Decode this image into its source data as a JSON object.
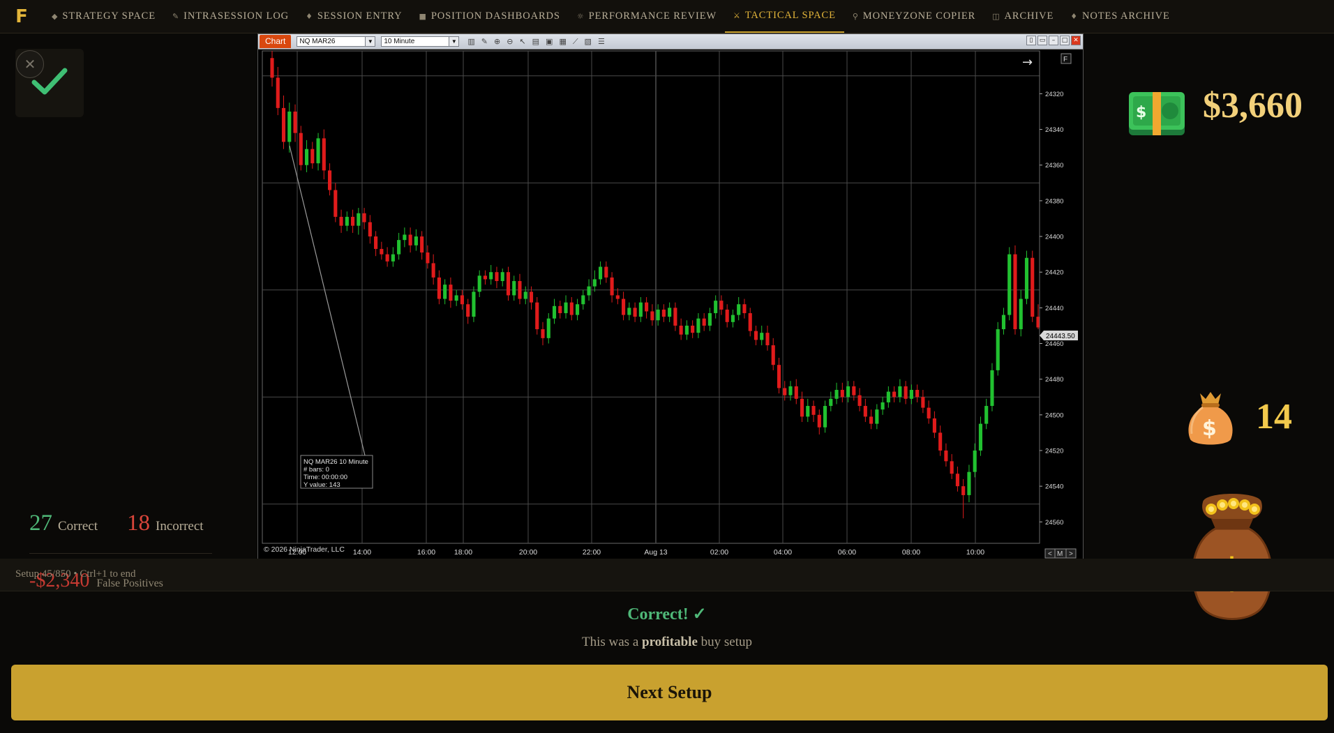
{
  "nav": {
    "logo": "F",
    "items": [
      {
        "icon": "◆",
        "label": "STRATEGY SPACE"
      },
      {
        "icon": "✎",
        "label": "INTRASESSION LOG"
      },
      {
        "icon": "♦",
        "label": "SESSION ENTRY"
      },
      {
        "icon": "■",
        "label": "POSITION DASHBOARDS"
      },
      {
        "icon": "☼",
        "label": "PERFORMANCE REVIEW"
      },
      {
        "icon": "⚔",
        "label": "TACTICAL SPACE"
      },
      {
        "icon": "⚲",
        "label": "MONEYZONE COPIER"
      },
      {
        "icon": "◫",
        "label": "ARCHIVE"
      },
      {
        "icon": "♦",
        "label": "NOTES ARCHIVE"
      }
    ],
    "active": "TACTICAL SPACE"
  },
  "left": {
    "close_glyph": "✕",
    "correct_count": "27",
    "correct_label": "Correct",
    "incorrect_count": "18",
    "incorrect_label": "Incorrect",
    "false_positive_value": "-$2,340",
    "false_positive_label": "False Positives"
  },
  "chart_window": {
    "tab": "Chart",
    "instrument": "NQ MAR26",
    "interval": "10 Minute",
    "corner_flag": "F",
    "arrow_glyph": "→",
    "copyright": "© 2026 NinjaTrader, LLC",
    "nav_buttons": [
      "<",
      "M",
      ">"
    ],
    "tooltip": [
      "NQ MAR26 10 Minute",
      "# bars:    0",
      "Time:      00:00:00",
      "Y value:  143"
    ],
    "price_tag": "24443.50"
  },
  "chart_data": {
    "type": "candlestick",
    "x_tick_labels": [
      "12:00",
      "14:00",
      "16:00",
      "18:00",
      "20:00",
      "22:00",
      "Aug 13",
      "02:00",
      "04:00",
      "06:00",
      "08:00",
      "10:00"
    ],
    "y_ticks": [
      24320,
      24340,
      24360,
      24380,
      24400,
      24420,
      24440,
      24460,
      24480,
      24500,
      24520,
      24540,
      24560
    ],
    "y_range": [
      24296,
      24572
    ],
    "y_axis_inverted": true,
    "last_price": 24443.5,
    "colors": {
      "up": "#21c130",
      "down": "#e01b1b",
      "background": "#000000",
      "grid": "#4a4a4a"
    },
    "candles": [
      [
        24300,
        24311,
        24296,
        24316
      ],
      [
        24311,
        24328,
        24305,
        24332
      ],
      [
        24328,
        24347,
        24321,
        24351
      ],
      [
        24347,
        24330,
        24325,
        24353
      ],
      [
        24330,
        24342,
        24326,
        24347
      ],
      [
        24342,
        24360,
        24338,
        24363
      ],
      [
        24360,
        24351,
        24346,
        24364
      ],
      [
        24351,
        24359,
        24347,
        24362
      ],
      [
        24359,
        24345,
        24342,
        24363
      ],
      [
        24345,
        24363,
        24340,
        24368
      ],
      [
        24363,
        24374,
        24359,
        24377
      ],
      [
        24374,
        24389,
        24370,
        24392
      ],
      [
        24389,
        24394,
        24385,
        24398
      ],
      [
        24394,
        24389,
        24386,
        24397
      ],
      [
        24389,
        24394,
        24385,
        24398
      ],
      [
        24394,
        24387,
        24384,
        24399
      ],
      [
        24387,
        24392,
        24384,
        24396
      ],
      [
        24392,
        24400,
        24388,
        24404
      ],
      [
        24400,
        24407,
        24397,
        24411
      ],
      [
        24407,
        24410,
        24403,
        24413
      ],
      [
        24410,
        24414,
        24406,
        24417
      ],
      [
        24414,
        24410,
        24406,
        24417
      ],
      [
        24410,
        24402,
        24398,
        24413
      ],
      [
        24402,
        24399,
        24395,
        24406
      ],
      [
        24399,
        24405,
        24395,
        24409
      ],
      [
        24405,
        24400,
        24396,
        24408
      ],
      [
        24400,
        24409,
        24397,
        24413
      ],
      [
        24409,
        24415,
        24405,
        24418
      ],
      [
        24415,
        24423,
        24410,
        24427
      ],
      [
        24423,
        24435,
        24419,
        24438
      ],
      [
        24435,
        24427,
        24424,
        24438
      ],
      [
        24427,
        24436,
        24423,
        24440
      ],
      [
        24436,
        24433,
        24430,
        24439
      ],
      [
        24433,
        24438,
        24430,
        24441
      ],
      [
        24438,
        24445,
        24435,
        24449
      ],
      [
        24445,
        24431,
        24428,
        24448
      ],
      [
        24431,
        24422,
        24419,
        24434
      ],
      [
        24422,
        24424,
        24419,
        24427
      ],
      [
        24424,
        24420,
        24416,
        24427
      ],
      [
        24420,
        24425,
        24417,
        24429
      ],
      [
        24425,
        24420,
        24418,
        24428
      ],
      [
        24420,
        24433,
        24417,
        24436
      ],
      [
        24433,
        24425,
        24422,
        24436
      ],
      [
        24425,
        24435,
        24421,
        24438
      ],
      [
        24435,
        24431,
        24428,
        24438
      ],
      [
        24431,
        24437,
        24428,
        24441
      ],
      [
        24437,
        24452,
        24434,
        24455
      ],
      [
        24452,
        24457,
        24448,
        24461
      ],
      [
        24457,
        24446,
        24443,
        24460
      ],
      [
        24446,
        24439,
        24435,
        24449
      ],
      [
        24439,
        24443,
        24436,
        24446
      ],
      [
        24443,
        24437,
        24433,
        24446
      ],
      [
        24437,
        24444,
        24434,
        24447
      ],
      [
        24444,
        24438,
        24435,
        24447
      ],
      [
        24438,
        24433,
        24430,
        24441
      ],
      [
        24433,
        24428,
        24424,
        24436
      ],
      [
        24428,
        24424,
        24419,
        24431
      ],
      [
        24424,
        24417,
        24414,
        24427
      ],
      [
        24417,
        24423,
        24414,
        24426
      ],
      [
        24423,
        24433,
        24420,
        24437
      ],
      [
        24433,
        24435,
        24429,
        24438
      ],
      [
        24435,
        24444,
        24431,
        24447
      ],
      [
        24444,
        24440,
        24437,
        24447
      ],
      [
        24440,
        24445,
        24437,
        24448
      ],
      [
        24445,
        24437,
        24434,
        24448
      ],
      [
        24437,
        24442,
        24434,
        24446
      ],
      [
        24442,
        24447,
        24438,
        24450
      ],
      [
        24447,
        24441,
        24438,
        24450
      ],
      [
        24441,
        24445,
        24438,
        24448
      ],
      [
        24445,
        24440,
        24437,
        24448
      ],
      [
        24440,
        24450,
        24437,
        24453
      ],
      [
        24450,
        24455,
        24446,
        24458
      ],
      [
        24455,
        24450,
        24447,
        24458
      ],
      [
        24450,
        24454,
        24447,
        24457
      ],
      [
        24454,
        24446,
        24443,
        24457
      ],
      [
        24446,
        24450,
        24443,
        24453
      ],
      [
        24450,
        24443,
        24440,
        24453
      ],
      [
        24443,
        24436,
        24433,
        24446
      ],
      [
        24436,
        24441,
        24433,
        24444
      ],
      [
        24441,
        24448,
        24438,
        24451
      ],
      [
        24448,
        24444,
        24441,
        24451
      ],
      [
        24444,
        24438,
        24434,
        24447
      ],
      [
        24438,
        24443,
        24435,
        24446
      ],
      [
        24443,
        24453,
        24440,
        24456
      ],
      [
        24453,
        24458,
        24450,
        24461
      ],
      [
        24458,
        24454,
        24450,
        24461
      ],
      [
        24454,
        24461,
        24450,
        24464
      ],
      [
        24461,
        24472,
        24457,
        24475
      ],
      [
        24472,
        24485,
        24468,
        24488
      ],
      [
        24485,
        24489,
        24481,
        24492
      ],
      [
        24489,
        24484,
        24481,
        24492
      ],
      [
        24484,
        24491,
        24480,
        24494
      ],
      [
        24491,
        24501,
        24487,
        24504
      ],
      [
        24501,
        24495,
        24491,
        24504
      ],
      [
        24495,
        24500,
        24492,
        24504
      ],
      [
        24500,
        24507,
        24497,
        24511
      ],
      [
        24507,
        24495,
        24492,
        24510
      ],
      [
        24495,
        24491,
        24487,
        24498
      ],
      [
        24491,
        24486,
        24482,
        24494
      ],
      [
        24486,
        24490,
        24482,
        24493
      ],
      [
        24490,
        24484,
        24481,
        24493
      ],
      [
        24484,
        24489,
        24481,
        24492
      ],
      [
        24489,
        24495,
        24485,
        24498
      ],
      [
        24495,
        24501,
        24491,
        24504
      ],
      [
        24501,
        24505,
        24497,
        24508
      ],
      [
        24505,
        24497,
        24494,
        24508
      ],
      [
        24497,
        24493,
        24490,
        24500
      ],
      [
        24493,
        24487,
        24484,
        24496
      ],
      [
        24487,
        24490,
        24484,
        24493
      ],
      [
        24490,
        24484,
        24480,
        24493
      ],
      [
        24484,
        24491,
        24481,
        24494
      ],
      [
        24491,
        24486,
        24483,
        24494
      ],
      [
        24486,
        24490,
        24483,
        24493
      ],
      [
        24490,
        24496,
        24486,
        24499
      ],
      [
        24496,
        24502,
        24492,
        24505
      ],
      [
        24502,
        24510,
        24498,
        24513
      ],
      [
        24510,
        24520,
        24506,
        24523
      ],
      [
        24520,
        24526,
        24516,
        24529
      ],
      [
        24526,
        24533,
        24522,
        24536
      ],
      [
        24533,
        24540,
        24529,
        24543
      ],
      [
        24540,
        24545,
        24536,
        24558
      ],
      [
        24545,
        24532,
        24528,
        24549
      ],
      [
        24532,
        24520,
        24516,
        24535
      ],
      [
        24520,
        24505,
        24501,
        24523
      ],
      [
        24505,
        24495,
        24491,
        24508
      ],
      [
        24495,
        24475,
        24471,
        24498
      ],
      [
        24475,
        24452,
        24448,
        24478
      ],
      [
        24452,
        24444,
        24440,
        24455
      ],
      [
        24444,
        24410,
        24406,
        24447
      ],
      [
        24410,
        24452,
        24405,
        24455
      ],
      [
        24452,
        24435,
        24430,
        24456
      ],
      [
        24435,
        24412,
        24408,
        24438
      ],
      [
        24412,
        24445,
        24408,
        24448
      ],
      [
        24445,
        24451,
        24438,
        24452
      ]
    ]
  },
  "right": {
    "cash_amount": "$3,660",
    "bag_count": "14"
  },
  "bottom": {
    "setup_text": "Setup 45/850 • Ctrl+1 to end",
    "result_title": "Correct! ✓",
    "result_prefix": "This was a ",
    "result_bold": "profitable",
    "result_suffix": " buy setup",
    "next_button": "Next Setup"
  }
}
